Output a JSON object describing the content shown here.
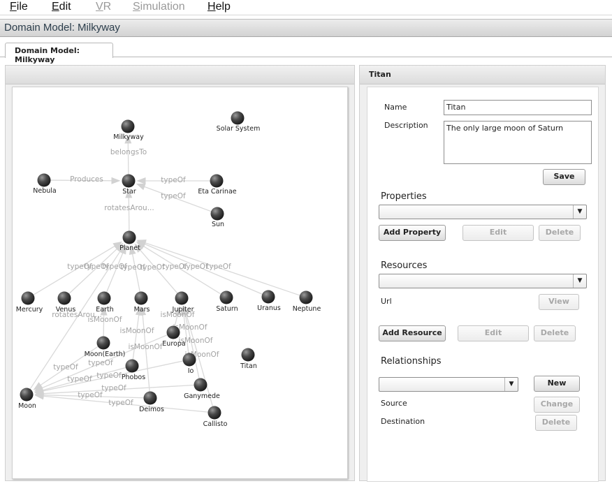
{
  "menu": [
    {
      "mnemonic": "F",
      "rest": "ile",
      "enabled": true
    },
    {
      "mnemonic": "E",
      "rest": "dit",
      "enabled": true
    },
    {
      "mnemonic": "V",
      "rest": "R",
      "enabled": false
    },
    {
      "mnemonic": "S",
      "rest": "imulation",
      "enabled": false
    },
    {
      "mnemonic": "H",
      "rest": "elp",
      "enabled": true
    }
  ],
  "window_title": "Domain Model: Milkyway",
  "tab_label": "Domain Model: Milkyway",
  "detail": {
    "header": "Titan",
    "name_label": "Name",
    "name_value": "Titan",
    "description_label": "Description",
    "description_value": "The only large moon of Saturn",
    "save_label": "Save",
    "properties_title": "Properties",
    "add_property_label": "Add Property",
    "edit_label": "Edit",
    "delete_label": "Delete",
    "resources_title": "Resources",
    "url_label": "Url",
    "view_label": "View",
    "add_resource_label": "Add Resource",
    "relationships_title": "Relationships",
    "new_label": "New",
    "source_label": "Source",
    "change_label": "Change",
    "destination_label": "Destination"
  },
  "graph": {
    "nodes": [
      {
        "id": "milkyway",
        "label": "Milkyway"
      },
      {
        "id": "solar_system",
        "label": "Solar System"
      },
      {
        "id": "nebula",
        "label": "Nebula"
      },
      {
        "id": "star",
        "label": "Star"
      },
      {
        "id": "eta_carinae",
        "label": "Eta Carinae"
      },
      {
        "id": "sun",
        "label": "Sun"
      },
      {
        "id": "planet",
        "label": "Planet"
      },
      {
        "id": "mercury",
        "label": "Mercury"
      },
      {
        "id": "venus",
        "label": "Venus"
      },
      {
        "id": "earth",
        "label": "Earth"
      },
      {
        "id": "mars",
        "label": "Mars"
      },
      {
        "id": "jupiter",
        "label": "Jupiter"
      },
      {
        "id": "saturn",
        "label": "Saturn"
      },
      {
        "id": "uranus",
        "label": "Uranus"
      },
      {
        "id": "neptune",
        "label": "Neptune"
      },
      {
        "id": "europa",
        "label": "Europa"
      },
      {
        "id": "moon_earth",
        "label": "Moon(Earth)"
      },
      {
        "id": "io",
        "label": "Io"
      },
      {
        "id": "titan",
        "label": "Titan"
      },
      {
        "id": "phobos",
        "label": "Phobos"
      },
      {
        "id": "moon",
        "label": "Moon"
      },
      {
        "id": "ganymede",
        "label": "Ganymede"
      },
      {
        "id": "deimos",
        "label": "Deimos"
      },
      {
        "id": "callisto",
        "label": "Callisto"
      }
    ],
    "edges": [
      {
        "from": "star",
        "to": "milkyway",
        "label": "belongsTo"
      },
      {
        "from": "nebula",
        "to": "star",
        "label": "Produces"
      },
      {
        "from": "eta_carinae",
        "to": "star",
        "label": "typeOf"
      },
      {
        "from": "sun",
        "to": "star",
        "label": "typeOf"
      },
      {
        "from": "planet",
        "to": "star",
        "label": "rotatesArou..."
      },
      {
        "from": "mercury",
        "to": "planet",
        "label": "typeOf"
      },
      {
        "from": "venus",
        "to": "planet",
        "label": "typeOf"
      },
      {
        "from": "earth",
        "to": "planet",
        "label": "typeOf"
      },
      {
        "from": "mars",
        "to": "planet",
        "label": "typeOf"
      },
      {
        "from": "jupiter",
        "to": "planet",
        "label": "typeOf"
      },
      {
        "from": "saturn",
        "to": "planet",
        "label": "typeOf"
      },
      {
        "from": "uranus",
        "to": "planet",
        "label": "typeOf"
      },
      {
        "from": "neptune",
        "to": "planet",
        "label": "typeOf"
      },
      {
        "from": "moon",
        "to": "planet",
        "label": "rotatesArou..."
      },
      {
        "from": "moon_earth",
        "to": "earth",
        "label": "isMoonOf"
      },
      {
        "from": "phobos",
        "to": "mars",
        "label": "isMoonOf"
      },
      {
        "from": "deimos",
        "to": "mars",
        "label": "isMoonOf"
      },
      {
        "from": "europa",
        "to": "jupiter",
        "label": "isMoonOf"
      },
      {
        "from": "io",
        "to": "jupiter",
        "label": "isMoonOf"
      },
      {
        "from": "ganymede",
        "to": "jupiter",
        "label": "isMoonOf"
      },
      {
        "from": "callisto",
        "to": "jupiter",
        "label": "isMoonOf"
      },
      {
        "from": "moon_earth",
        "to": "moon",
        "label": "typeOf"
      },
      {
        "from": "phobos",
        "to": "moon",
        "label": "typeOf"
      },
      {
        "from": "io",
        "to": "moon",
        "label": "typeOf"
      },
      {
        "from": "europa",
        "to": "moon",
        "label": "typeOf"
      },
      {
        "from": "ganymede",
        "to": "moon",
        "label": "typeOf"
      },
      {
        "from": "deimos",
        "to": "moon",
        "label": "typeOf"
      },
      {
        "from": "callisto",
        "to": "moon",
        "label": "typeOf"
      }
    ]
  }
}
